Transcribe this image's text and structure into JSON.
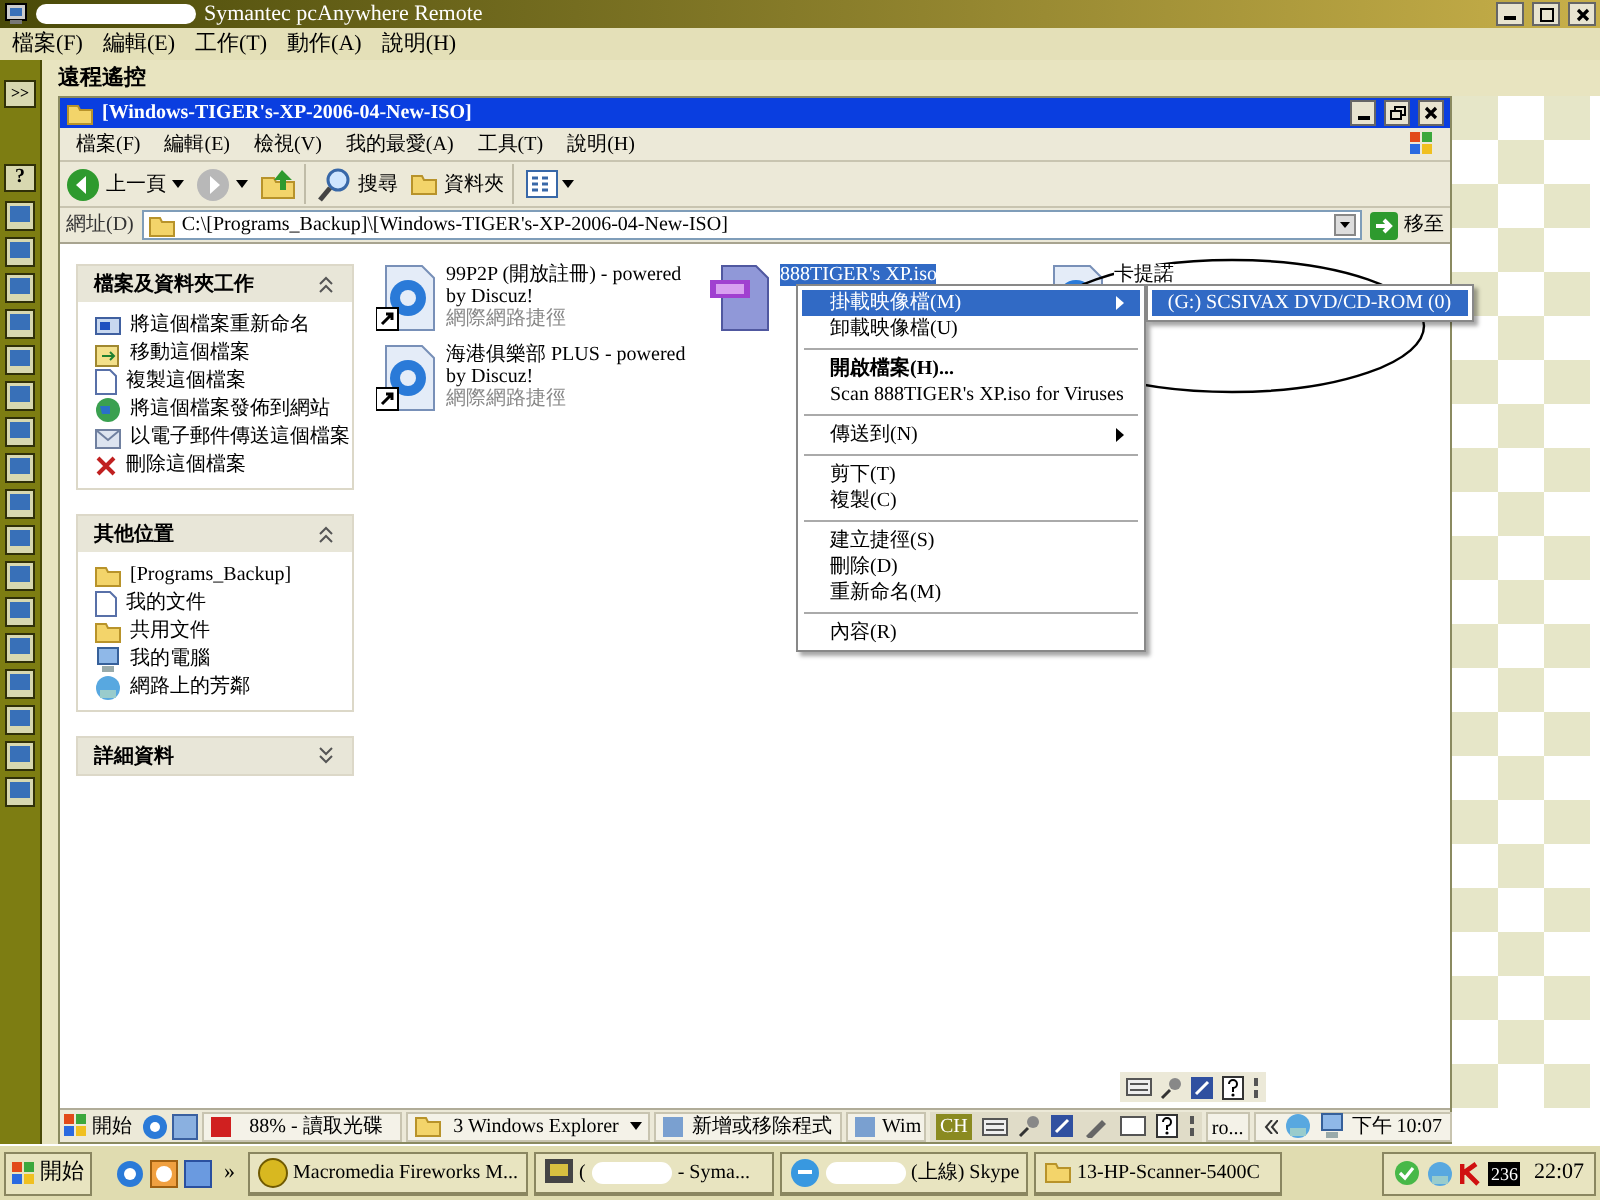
{
  "app": {
    "title": "Symantec pcAnywhere Remote",
    "menu": [
      "檔案(F)",
      "編輯(E)",
      "工作(T)",
      "動作(A)",
      "說明(H)"
    ],
    "side_buttons": [
      ">>",
      "?"
    ],
    "panel_title": "遠程遙控"
  },
  "explorer": {
    "title": "[Windows-TIGER's-XP-2006-04-New-ISO]",
    "menu": [
      "檔案(F)",
      "編輯(E)",
      "檢視(V)",
      "我的最愛(A)",
      "工具(T)",
      "說明(H)"
    ],
    "toolbar": [
      {
        "kind": "back",
        "label": "上一頁"
      },
      {
        "kind": "forward"
      },
      {
        "kind": "up"
      },
      {
        "kind": "search",
        "label": "搜尋"
      },
      {
        "kind": "folders",
        "label": "資料夾"
      },
      {
        "kind": "views"
      }
    ],
    "address": {
      "label": "網址(D)",
      "value": "C:\\[Programs_Backup]\\[Windows-TIGER's-XP-2006-04-New-ISO]",
      "go": "移至"
    },
    "task_panes": [
      {
        "title": "檔案及資料夾工作",
        "expanded": true,
        "items": [
          "將這個檔案重新命名",
          "移動這個檔案",
          "複製這個檔案",
          "將這個檔案發佈到網站",
          "以電子郵件傳送這個檔案",
          "刪除這個檔案"
        ]
      },
      {
        "title": "其他位置",
        "expanded": true,
        "items": [
          "[Programs_Backup]",
          "我的文件",
          "共用文件",
          "我的電腦",
          "網路上的芳鄰"
        ]
      },
      {
        "title": "詳細資料",
        "expanded": false
      }
    ],
    "files": [
      {
        "kind": "shortcut",
        "name": "99P2P (開放註冊) - powered by Discuz!",
        "type": "網際網路捷徑",
        "selected": false
      },
      {
        "kind": "iso",
        "name": "888TIGER's XP.iso",
        "selected": true
      },
      {
        "kind": "shortcut",
        "name": "卡提諾",
        "selected": false
      },
      {
        "kind": "shortcut",
        "name": "海港俱樂部 PLUS - powered by Discuz!",
        "type": "網際網路捷徑",
        "selected": false
      }
    ],
    "context_menu": [
      {
        "kind": "item",
        "label": "掛載映像檔(M)",
        "selected": true,
        "bold": false,
        "submenu": true
      },
      {
        "kind": "item",
        "label": "卸載映像檔(U)",
        "selected": false,
        "bold": false,
        "submenu": false
      },
      {
        "kind": "separator"
      },
      {
        "kind": "item",
        "label": "開啟檔案(H)...",
        "selected": false,
        "bold": true,
        "submenu": false
      },
      {
        "kind": "item",
        "label": "Scan 888TIGER's XP.iso for Viruses",
        "selected": false,
        "bold": false,
        "submenu": false
      },
      {
        "kind": "separator"
      },
      {
        "kind": "item",
        "label": "傳送到(N)",
        "selected": false,
        "bold": false,
        "submenu": true
      },
      {
        "kind": "separator"
      },
      {
        "kind": "item",
        "label": "剪下(T)",
        "selected": false,
        "bold": false,
        "submenu": false
      },
      {
        "kind": "item",
        "label": "複製(C)",
        "selected": false,
        "bold": false,
        "submenu": false
      },
      {
        "kind": "separator"
      },
      {
        "kind": "item",
        "label": "建立捷徑(S)",
        "selected": false,
        "bold": false,
        "submenu": false
      },
      {
        "kind": "item",
        "label": "刪除(D)",
        "selected": false,
        "bold": false,
        "submenu": false
      },
      {
        "kind": "item",
        "label": "重新命名(M)",
        "selected": false,
        "bold": false,
        "submenu": false
      },
      {
        "kind": "separator"
      },
      {
        "kind": "item",
        "label": "內容(R)",
        "selected": false,
        "bold": false,
        "submenu": false
      }
    ],
    "submenu": [
      {
        "label": "(G:) SCSIVAX DVD/CD-ROM (0)",
        "selected": true
      }
    ]
  },
  "remote_taskbar": {
    "start": "開始",
    "tasks": [
      {
        "kind": "app",
        "label": "88% - 讀取光碟"
      },
      {
        "kind": "group",
        "label": "3 Windows Explorer"
      },
      {
        "kind": "app",
        "label": "新增或移除程式"
      },
      {
        "kind": "app",
        "label": "Wim"
      }
    ],
    "language": "CH",
    "hidden_task": "ro...",
    "clock": "下午 10:07"
  },
  "taskbar": {
    "start": "開始",
    "more": "»",
    "tasks": [
      {
        "kind": "app",
        "label": "Macromedia Fireworks M..."
      },
      {
        "kind": "redacted",
        "label": "- Syma...",
        "prefix": "("
      },
      {
        "kind": "redacted",
        "label": "(上線) Skype"
      },
      {
        "kind": "folder",
        "label": "13-HP-Scanner-5400C"
      }
    ],
    "tray_badge": "236",
    "clock": "22:07"
  }
}
